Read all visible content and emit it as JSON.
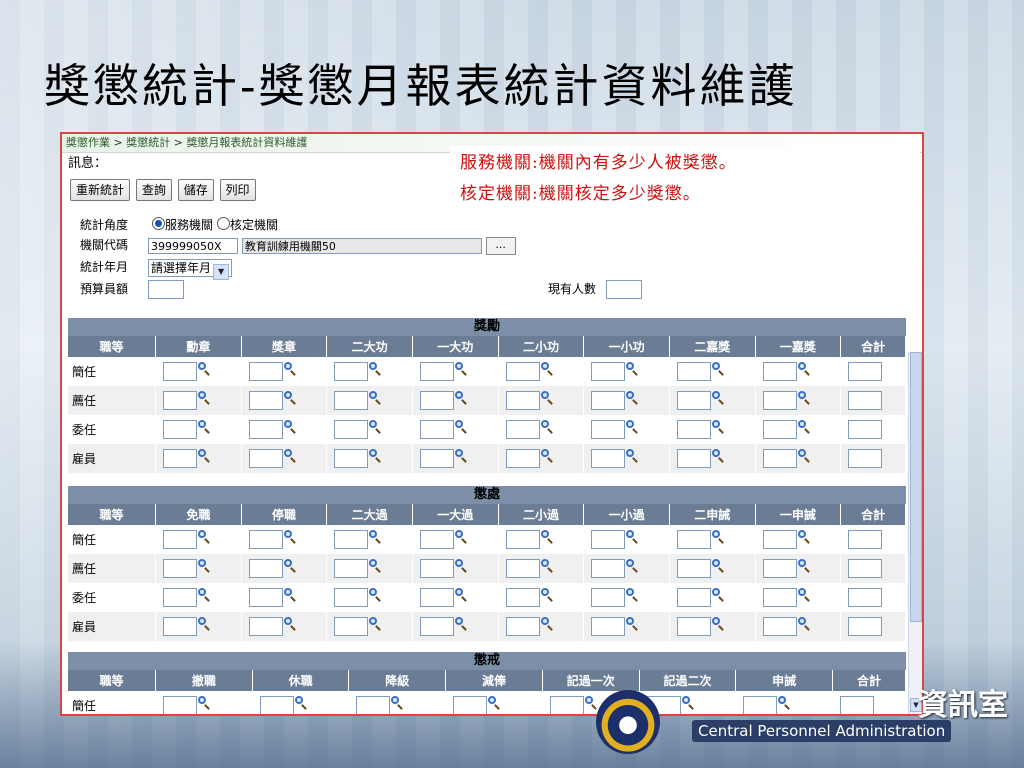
{
  "slide": {
    "title": "獎懲統計-獎懲月報表統計資料維護",
    "logo_cn": "資訊室",
    "logo_en": "Central Personnel Administration"
  },
  "app": {
    "breadcrumb": [
      "獎懲作業",
      "獎懲統計",
      "獎懲月報表統計資料維護"
    ],
    "breadcrumb_sep": " > ",
    "message_label": "訊息：",
    "buttons": [
      "重新統計",
      "查詢",
      "儲存",
      "列印"
    ],
    "form": {
      "angle_label": "統計角度",
      "angle_options": [
        "服務機關",
        "核定機關"
      ],
      "angle_selected": "服務機關",
      "org_code_label": "機關代碼",
      "org_code_value": "399999050X",
      "org_name_value": "教育訓練用機關50",
      "lookup_btn": "...",
      "year_month_label": "統計年月",
      "year_month_value": "請選擇年月",
      "budget_label": "預算員額",
      "budget_value": "",
      "current_label": "現有人數",
      "current_value": ""
    },
    "rows": [
      "簡任",
      "薦任",
      "委任",
      "雇員"
    ],
    "reward": {
      "title": "獎勵",
      "columns": [
        "職等",
        "勳章",
        "獎章",
        "二大功",
        "一大功",
        "二小功",
        "一小功",
        "二嘉獎",
        "一嘉獎",
        "合計"
      ]
    },
    "punish": {
      "title": "懲處",
      "columns": [
        "職等",
        "免職",
        "停職",
        "二大過",
        "一大過",
        "二小過",
        "一小過",
        "二申誡",
        "一申誡",
        "合計"
      ]
    },
    "discipline": {
      "title": "懲戒",
      "columns": [
        "職等",
        "撤職",
        "休職",
        "降級",
        "減俸",
        "記過一次",
        "記過二次",
        "申誡",
        "合計"
      ],
      "first_row": "簡任"
    }
  },
  "annotation": {
    "line1": "服務機關:機關內有多少人被獎懲。",
    "line2": "核定機關:機關核定多少獎懲。"
  },
  "colors": {
    "annotation_text": "#d01010",
    "header_bg": "#6b7c95",
    "frame_border": "#d44"
  }
}
